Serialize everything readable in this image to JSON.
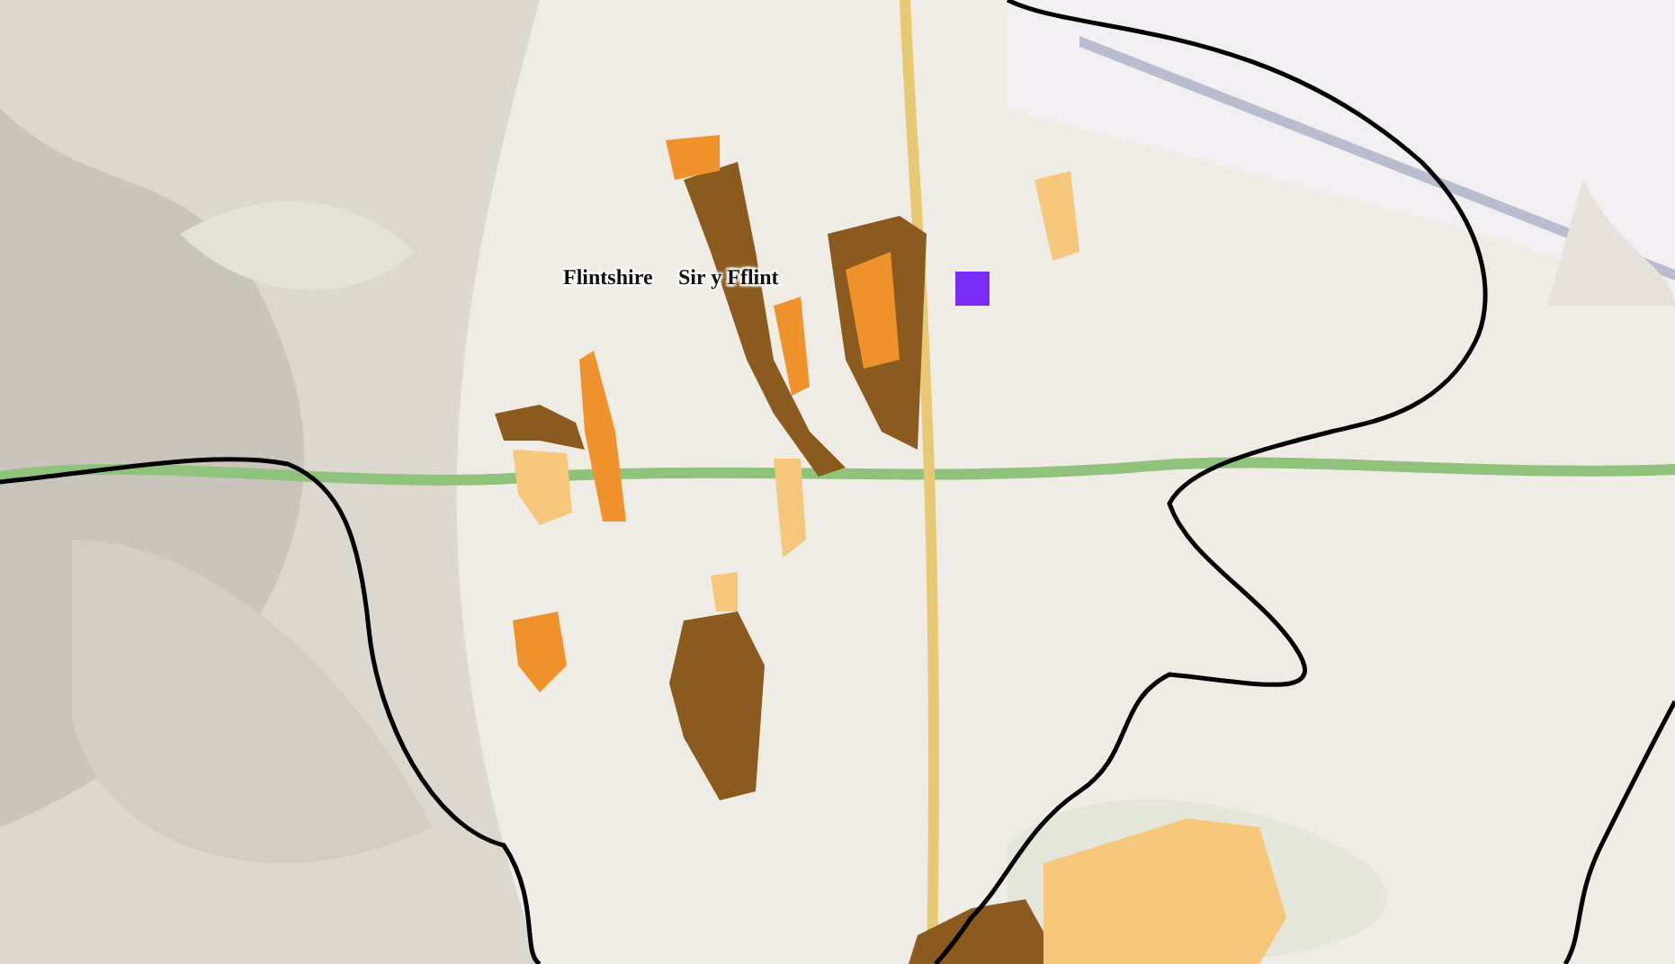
{
  "zones": [
    {
      "color": "#8b5a1e"
    },
    {
      "color": "#f0922b"
    },
    {
      "color": "#f6c67a"
    }
  ],
  "labels": [
    {
      "text": "Flintshire"
    },
    {
      "text": "Sir y Fflint"
    }
  ],
  "marker": {
    "color": "#7a2ef5"
  }
}
